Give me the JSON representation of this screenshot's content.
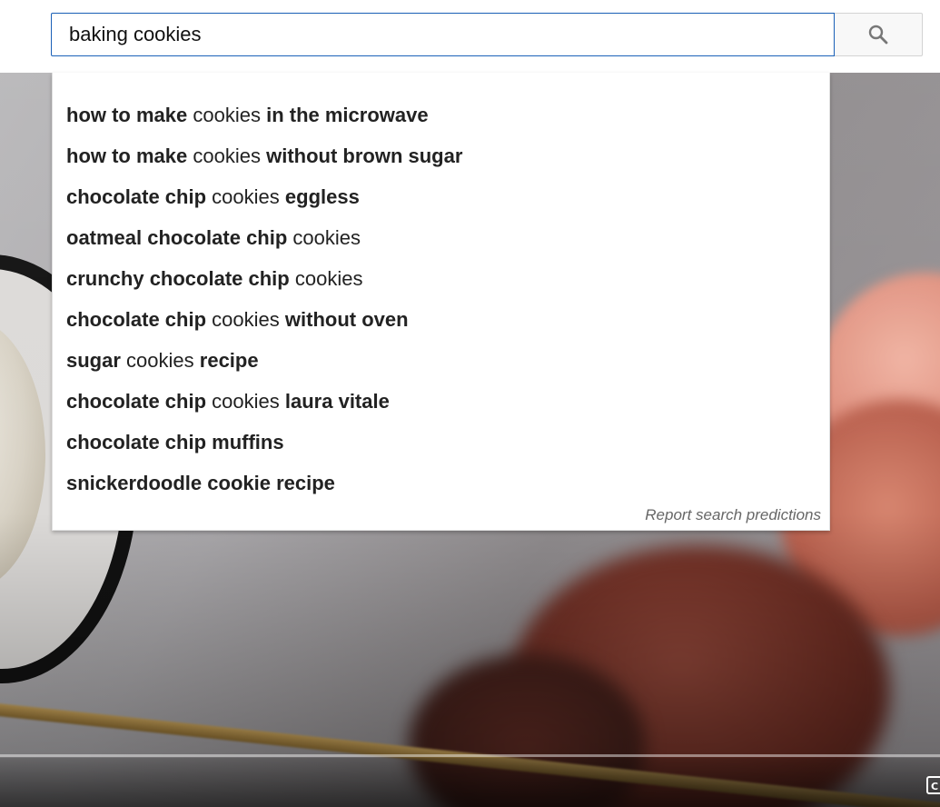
{
  "search": {
    "value": "baking cookies",
    "button_icon": "search-icon"
  },
  "suggestions": [
    {
      "prefix": "how to make",
      "query": "cookies",
      "suffix": "in the microwave"
    },
    {
      "prefix": "how to make",
      "query": "cookies",
      "suffix": "without brown sugar"
    },
    {
      "prefix": "chocolate chip",
      "query": "cookies",
      "suffix": "eggless"
    },
    {
      "prefix": "oatmeal chocolate chip",
      "query": "cookies",
      "suffix": ""
    },
    {
      "prefix": "crunchy chocolate chip",
      "query": "cookies",
      "suffix": ""
    },
    {
      "prefix": "chocolate chip",
      "query": "cookies",
      "suffix": "without oven"
    },
    {
      "prefix": "sugar",
      "query": "cookies",
      "suffix": "recipe"
    },
    {
      "prefix": "chocolate chip",
      "query": "cookies",
      "suffix": "laura vitale"
    },
    {
      "prefix": "chocolate chip muffins",
      "query": "",
      "suffix": ""
    },
    {
      "prefix": "snickerdoodle cookie recipe",
      "query": "",
      "suffix": ""
    }
  ],
  "report_link": "Report search predictions",
  "player": {
    "cc_icon": "closed-captions-icon"
  },
  "colors": {
    "input_border": "#1c62b9",
    "suggestion_text": "#222222",
    "report_text": "#666666"
  }
}
